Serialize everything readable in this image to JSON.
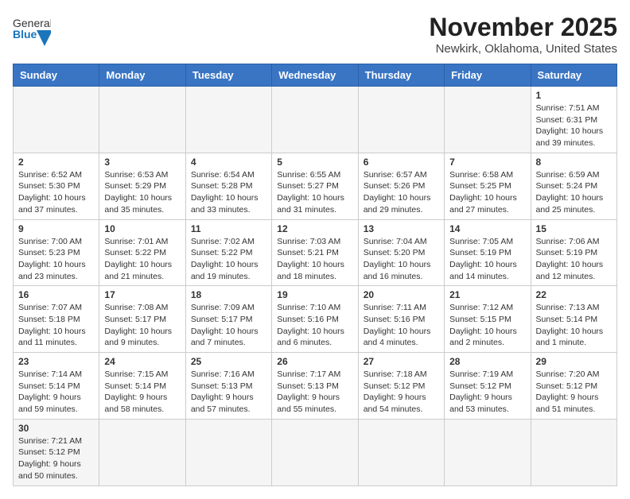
{
  "logo": {
    "general": "General",
    "blue": "Blue"
  },
  "title": "November 2025",
  "subtitle": "Newkirk, Oklahoma, United States",
  "days_of_week": [
    "Sunday",
    "Monday",
    "Tuesday",
    "Wednesday",
    "Thursday",
    "Friday",
    "Saturday"
  ],
  "weeks": [
    [
      {
        "day": "",
        "info": "",
        "empty": true
      },
      {
        "day": "",
        "info": "",
        "empty": true
      },
      {
        "day": "",
        "info": "",
        "empty": true
      },
      {
        "day": "",
        "info": "",
        "empty": true
      },
      {
        "day": "",
        "info": "",
        "empty": true
      },
      {
        "day": "",
        "info": "",
        "empty": true
      },
      {
        "day": "1",
        "info": "Sunrise: 7:51 AM\nSunset: 6:31 PM\nDaylight: 10 hours and 39 minutes."
      }
    ],
    [
      {
        "day": "2",
        "info": "Sunrise: 6:52 AM\nSunset: 5:30 PM\nDaylight: 10 hours and 37 minutes."
      },
      {
        "day": "3",
        "info": "Sunrise: 6:53 AM\nSunset: 5:29 PM\nDaylight: 10 hours and 35 minutes."
      },
      {
        "day": "4",
        "info": "Sunrise: 6:54 AM\nSunset: 5:28 PM\nDaylight: 10 hours and 33 minutes."
      },
      {
        "day": "5",
        "info": "Sunrise: 6:55 AM\nSunset: 5:27 PM\nDaylight: 10 hours and 31 minutes."
      },
      {
        "day": "6",
        "info": "Sunrise: 6:57 AM\nSunset: 5:26 PM\nDaylight: 10 hours and 29 minutes."
      },
      {
        "day": "7",
        "info": "Sunrise: 6:58 AM\nSunset: 5:25 PM\nDaylight: 10 hours and 27 minutes."
      },
      {
        "day": "8",
        "info": "Sunrise: 6:59 AM\nSunset: 5:24 PM\nDaylight: 10 hours and 25 minutes."
      }
    ],
    [
      {
        "day": "9",
        "info": "Sunrise: 7:00 AM\nSunset: 5:23 PM\nDaylight: 10 hours and 23 minutes."
      },
      {
        "day": "10",
        "info": "Sunrise: 7:01 AM\nSunset: 5:22 PM\nDaylight: 10 hours and 21 minutes."
      },
      {
        "day": "11",
        "info": "Sunrise: 7:02 AM\nSunset: 5:22 PM\nDaylight: 10 hours and 19 minutes."
      },
      {
        "day": "12",
        "info": "Sunrise: 7:03 AM\nSunset: 5:21 PM\nDaylight: 10 hours and 18 minutes."
      },
      {
        "day": "13",
        "info": "Sunrise: 7:04 AM\nSunset: 5:20 PM\nDaylight: 10 hours and 16 minutes."
      },
      {
        "day": "14",
        "info": "Sunrise: 7:05 AM\nSunset: 5:19 PM\nDaylight: 10 hours and 14 minutes."
      },
      {
        "day": "15",
        "info": "Sunrise: 7:06 AM\nSunset: 5:19 PM\nDaylight: 10 hours and 12 minutes."
      }
    ],
    [
      {
        "day": "16",
        "info": "Sunrise: 7:07 AM\nSunset: 5:18 PM\nDaylight: 10 hours and 11 minutes."
      },
      {
        "day": "17",
        "info": "Sunrise: 7:08 AM\nSunset: 5:17 PM\nDaylight: 10 hours and 9 minutes."
      },
      {
        "day": "18",
        "info": "Sunrise: 7:09 AM\nSunset: 5:17 PM\nDaylight: 10 hours and 7 minutes."
      },
      {
        "day": "19",
        "info": "Sunrise: 7:10 AM\nSunset: 5:16 PM\nDaylight: 10 hours and 6 minutes."
      },
      {
        "day": "20",
        "info": "Sunrise: 7:11 AM\nSunset: 5:16 PM\nDaylight: 10 hours and 4 minutes."
      },
      {
        "day": "21",
        "info": "Sunrise: 7:12 AM\nSunset: 5:15 PM\nDaylight: 10 hours and 2 minutes."
      },
      {
        "day": "22",
        "info": "Sunrise: 7:13 AM\nSunset: 5:14 PM\nDaylight: 10 hours and 1 minute."
      }
    ],
    [
      {
        "day": "23",
        "info": "Sunrise: 7:14 AM\nSunset: 5:14 PM\nDaylight: 9 hours and 59 minutes."
      },
      {
        "day": "24",
        "info": "Sunrise: 7:15 AM\nSunset: 5:14 PM\nDaylight: 9 hours and 58 minutes."
      },
      {
        "day": "25",
        "info": "Sunrise: 7:16 AM\nSunset: 5:13 PM\nDaylight: 9 hours and 57 minutes."
      },
      {
        "day": "26",
        "info": "Sunrise: 7:17 AM\nSunset: 5:13 PM\nDaylight: 9 hours and 55 minutes."
      },
      {
        "day": "27",
        "info": "Sunrise: 7:18 AM\nSunset: 5:12 PM\nDaylight: 9 hours and 54 minutes."
      },
      {
        "day": "28",
        "info": "Sunrise: 7:19 AM\nSunset: 5:12 PM\nDaylight: 9 hours and 53 minutes."
      },
      {
        "day": "29",
        "info": "Sunrise: 7:20 AM\nSunset: 5:12 PM\nDaylight: 9 hours and 51 minutes."
      }
    ],
    [
      {
        "day": "30",
        "info": "Sunrise: 7:21 AM\nSunset: 5:12 PM\nDaylight: 9 hours and 50 minutes.",
        "last": true
      },
      {
        "day": "",
        "info": "",
        "empty": true,
        "last": true
      },
      {
        "day": "",
        "info": "",
        "empty": true,
        "last": true
      },
      {
        "day": "",
        "info": "",
        "empty": true,
        "last": true
      },
      {
        "day": "",
        "info": "",
        "empty": true,
        "last": true
      },
      {
        "day": "",
        "info": "",
        "empty": true,
        "last": true
      },
      {
        "day": "",
        "info": "",
        "empty": true,
        "last": true
      }
    ]
  ]
}
